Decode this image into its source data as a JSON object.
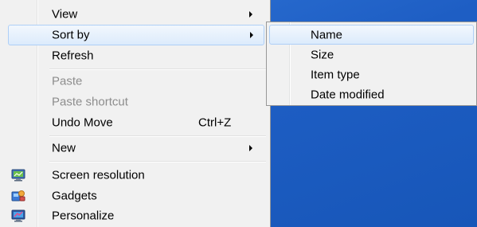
{
  "context_menu": {
    "items": [
      {
        "label": "View",
        "has_submenu": true,
        "enabled": true
      },
      {
        "label": "Sort by",
        "has_submenu": true,
        "enabled": true,
        "highlighted": true
      },
      {
        "label": "Refresh",
        "enabled": true
      },
      {
        "label": "Paste",
        "enabled": false
      },
      {
        "label": "Paste shortcut",
        "enabled": false
      },
      {
        "label": "Undo Move",
        "shortcut": "Ctrl+Z",
        "enabled": true
      },
      {
        "label": "New",
        "has_submenu": true,
        "enabled": true
      },
      {
        "label": "Screen resolution",
        "icon": "screen-resolution-icon",
        "enabled": true
      },
      {
        "label": "Gadgets",
        "icon": "gadgets-icon",
        "enabled": true
      },
      {
        "label": "Personalize",
        "icon": "personalize-icon",
        "enabled": true
      }
    ]
  },
  "sort_submenu": {
    "items": [
      {
        "label": "Name",
        "highlighted": true
      },
      {
        "label": "Size"
      },
      {
        "label": "Item type"
      },
      {
        "label": "Date modified"
      }
    ]
  },
  "colors": {
    "desktop_blue": "#1e5ec4",
    "menu_background": "#f1f1f1",
    "highlight_border": "#aecff7",
    "disabled_text": "#8d8d8d"
  }
}
